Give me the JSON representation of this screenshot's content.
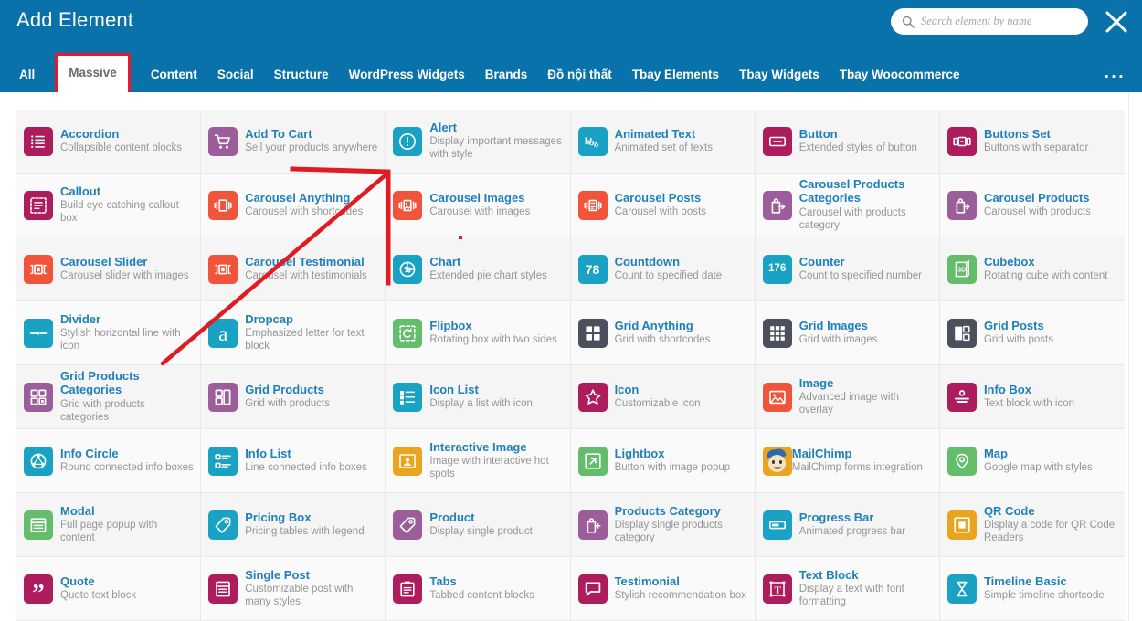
{
  "header": {
    "title": "Add Element",
    "close_label": "×",
    "search": {
      "placeholder": "Search element by name",
      "value": "",
      "icon": "search-icon"
    }
  },
  "tabs": {
    "items": [
      {
        "label": "All",
        "active": false
      },
      {
        "label": "Massive",
        "active": true
      },
      {
        "label": "Content",
        "active": false
      },
      {
        "label": "Social",
        "active": false
      },
      {
        "label": "Structure",
        "active": false
      },
      {
        "label": "WordPress Widgets",
        "active": false
      },
      {
        "label": "Brands",
        "active": false
      },
      {
        "label": "Đồ nội thất",
        "active": false
      },
      {
        "label": "Tbay Elements",
        "active": false
      },
      {
        "label": "Tbay Widgets",
        "active": false
      },
      {
        "label": "Tbay Woocommerce",
        "active": false
      }
    ],
    "overflow_label": "...",
    "active_border_color": "#e8192c"
  },
  "colors": {
    "header_blue": "#0a72ab",
    "title_blue": "#2080b9",
    "desc_gray": "#969696",
    "crimson": "#ad1d5e",
    "purple": "#9b5e9b",
    "cyan": "#19a2c4",
    "orange_red": "#f0553c",
    "green": "#63bd6a",
    "amber": "#eaa41e",
    "slate": "#4c505c",
    "annotation_red": "#e01b22"
  },
  "elements": [
    {
      "title": "Accordion",
      "desc": "Collapsible content blocks",
      "icon": "list-lines-icon",
      "color": "#ad1d5e"
    },
    {
      "title": "Add To Cart",
      "desc": "Sell your products anywhere",
      "icon": "shopping-cart-icon",
      "color": "#9b5e9b"
    },
    {
      "title": "Alert",
      "desc": "Display important messages with style",
      "icon": "exclamation-circle-icon",
      "color": "#19a2c4"
    },
    {
      "title": "Animated Text",
      "desc": "Animated set of texts",
      "icon": "animated-letters-icon",
      "color": "#19a2c4"
    },
    {
      "title": "Button",
      "desc": "Extended styles of button",
      "icon": "button-rect-icon",
      "color": "#ad1d5e"
    },
    {
      "title": "Buttons Set",
      "desc": "Buttons with separator",
      "icon": "buttons-set-icon",
      "color": "#ad1d5e"
    },
    {
      "title": "Callout",
      "desc": "Build eye catching callout box",
      "icon": "dashed-box-icon",
      "color": "#ad1d5e"
    },
    {
      "title": "Carousel Anything",
      "desc": "Carousel with shortcodes",
      "icon": "carousel-slide-icon",
      "color": "#f0553c"
    },
    {
      "title": "Carousel Images",
      "desc": "Carousel with images",
      "icon": "carousel-image-icon",
      "color": "#f0553c"
    },
    {
      "title": "Carousel Posts",
      "desc": "Carousel with posts",
      "icon": "carousel-posts-icon",
      "color": "#f0553c"
    },
    {
      "title": "Carousel Products Categories",
      "desc": "Carousel with products category",
      "icon": "bag-arrow-icon",
      "color": "#9b5e9b"
    },
    {
      "title": "Carousel Products",
      "desc": "Carousel with products",
      "icon": "bag-arrow-icon",
      "color": "#9b5e9b"
    },
    {
      "title": "Carousel Slider",
      "desc": "Carousel slider with images",
      "icon": "carousel-slider-icon",
      "color": "#f0553c"
    },
    {
      "title": "Carousel Testimonial",
      "desc": "Carousel with testimonials",
      "icon": "carousel-slider-icon",
      "color": "#f0553c"
    },
    {
      "title": "Chart",
      "desc": "Extended pie chart styles",
      "icon": "pie-percent-icon",
      "color": "#19a2c4"
    },
    {
      "title": "Countdown",
      "desc": "Count to specified date",
      "icon": "countdown-78-icon",
      "color": "#19a2c4",
      "glyph": "78"
    },
    {
      "title": "Counter",
      "desc": "Count to specified number",
      "icon": "counter-176-icon",
      "color": "#19a2c4",
      "glyph": "176"
    },
    {
      "title": "Cubebox",
      "desc": "Rotating cube with content",
      "icon": "cube-3d-icon",
      "color": "#63bd6a",
      "glyph": "3D"
    },
    {
      "title": "Divider",
      "desc": "Stylish horizontal line with icon",
      "icon": "divider-line-icon",
      "color": "#19a2c4"
    },
    {
      "title": "Dropcap",
      "desc": "Emphasized letter for text block",
      "icon": "letter-a-icon",
      "color": "#19a2c4",
      "glyph": "a"
    },
    {
      "title": "Flipbox",
      "desc": "Rotating box with two sides",
      "icon": "flip-refresh-icon",
      "color": "#63bd6a"
    },
    {
      "title": "Grid Anything",
      "desc": "Grid with shortcodes",
      "icon": "grid-four-icon",
      "color": "#4c505c"
    },
    {
      "title": "Grid Images",
      "desc": "Grid with images",
      "icon": "grid-nine-icon",
      "color": "#4c505c"
    },
    {
      "title": "Grid Posts",
      "desc": "Grid with posts",
      "icon": "grid-posts-icon",
      "color": "#4c505c"
    },
    {
      "title": "Grid Products Categories",
      "desc": "Grid with products categories",
      "icon": "grid-squares-icon",
      "color": "#9b5e9b"
    },
    {
      "title": "Grid Products",
      "desc": "Grid with products",
      "icon": "grid-products-icon",
      "color": "#9b5e9b"
    },
    {
      "title": "Icon List",
      "desc": "Display a list with icon.",
      "icon": "icon-list-icon",
      "color": "#19a2c4"
    },
    {
      "title": "Icon",
      "desc": "Customizable icon",
      "icon": "star-outline-icon",
      "color": "#ad1d5e"
    },
    {
      "title": "Image",
      "desc": "Advanced image with overlay",
      "icon": "picture-icon",
      "color": "#f0553c"
    },
    {
      "title": "Info Box",
      "desc": "Text block with icon",
      "icon": "info-box-icon",
      "color": "#ad1d5e"
    },
    {
      "title": "Info Circle",
      "desc": "Round connected info boxes",
      "icon": "info-circle-nodes-icon",
      "color": "#19a2c4"
    },
    {
      "title": "Info List",
      "desc": "Line connected info boxes",
      "icon": "info-list-icon",
      "color": "#19a2c4"
    },
    {
      "title": "Interactive Image",
      "desc": "Image with interactive hot spots",
      "icon": "interactive-hotspot-icon",
      "color": "#eaa41e"
    },
    {
      "title": "Lightbox",
      "desc": "Button with image popup",
      "icon": "expand-arrow-icon",
      "color": "#63bd6a"
    },
    {
      "title": "MailChimp",
      "desc": "MailChimp forms integration",
      "icon": "mailchimp-monkey-icon",
      "color": "#eaa41e"
    },
    {
      "title": "Map",
      "desc": "Google map with styles",
      "icon": "map-pin-icon",
      "color": "#63bd6a"
    },
    {
      "title": "Modal",
      "desc": "Full page popup with content",
      "icon": "modal-window-icon",
      "color": "#63bd6a"
    },
    {
      "title": "Pricing Box",
      "desc": "Pricing tables with legend",
      "icon": "price-tags-icon",
      "color": "#19a2c4"
    },
    {
      "title": "Product",
      "desc": "Display single product",
      "icon": "tag-icon",
      "color": "#9b5e9b"
    },
    {
      "title": "Products Category",
      "desc": "Display single products category",
      "icon": "bag-plus-icon",
      "color": "#9b5e9b"
    },
    {
      "title": "Progress Bar",
      "desc": "Animated progress bar",
      "icon": "progress-bar-icon",
      "color": "#19a2c4"
    },
    {
      "title": "QR Code",
      "desc": "Display a code for QR Code Readers",
      "icon": "qr-square-icon",
      "color": "#eaa41e"
    },
    {
      "title": "Quote",
      "desc": "Quote text block",
      "icon": "quote-marks-icon",
      "color": "#ad1d5e",
      "glyph": "”"
    },
    {
      "title": "Single Post",
      "desc": "Customizable post with many styles",
      "icon": "single-post-icon",
      "color": "#ad1d5e"
    },
    {
      "title": "Tabs",
      "desc": "Tabbed content blocks",
      "icon": "tabs-clipboard-icon",
      "color": "#ad1d5e"
    },
    {
      "title": "Testimonial",
      "desc": "Stylish recommendation box",
      "icon": "speech-bubble-icon",
      "color": "#ad1d5e"
    },
    {
      "title": "Text Block",
      "desc": "Display a text with font formatting",
      "icon": "text-t-icon",
      "color": "#ad1d5e"
    },
    {
      "title": "Timeline Basic",
      "desc": "Simple timeline shortcode",
      "icon": "hourglass-icon",
      "color": "#19a2c4"
    }
  ]
}
